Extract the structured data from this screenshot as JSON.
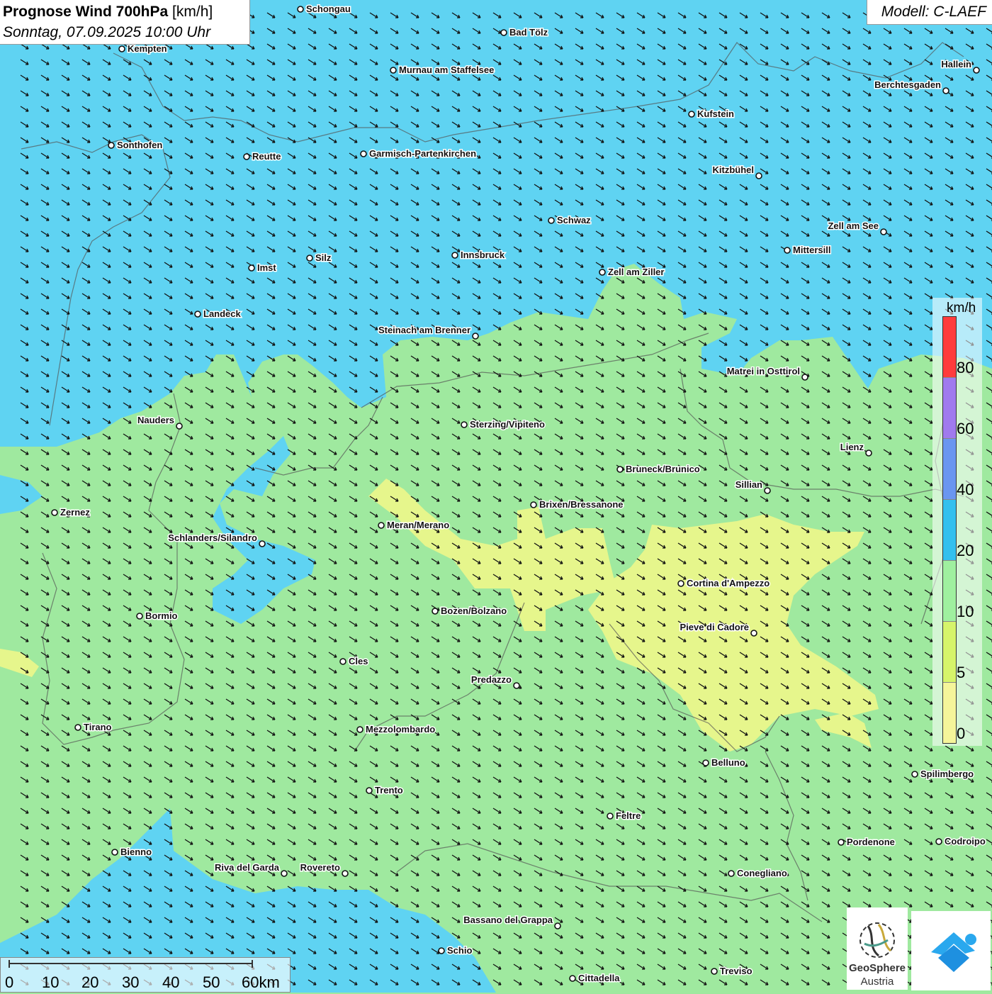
{
  "title": {
    "main": "Prognose Wind 700hPa",
    "unit": "[km/h]",
    "datetime": "Sonntag, 07.09.2025 10:00 Uhr"
  },
  "model": "Modell: C-LAEF",
  "colors": {
    "water": "#5fd4f2",
    "calm_green": "#a0ee9f",
    "yellow": "#e8f790",
    "dark_blue": "#3fb8ee"
  },
  "legend": {
    "unit": "km/h",
    "labels": [
      "80",
      "60",
      "40",
      "20",
      "10",
      "5",
      "0"
    ],
    "colors": [
      "#ff3c3c",
      "#a07aee",
      "#6a96f0",
      "#33c0ee",
      "#9ff09f",
      "#d6f46a",
      "#f5f59a"
    ]
  },
  "cities": [
    {
      "name": "Schongau"
    },
    {
      "name": "Bad Tölz"
    },
    {
      "name": "Kempten"
    },
    {
      "name": "Murnau am Staffelsee"
    },
    {
      "name": "Hallein"
    },
    {
      "name": "Berchtesgaden"
    },
    {
      "name": "Kufstein"
    },
    {
      "name": "Sonthofen"
    },
    {
      "name": "Reutte"
    },
    {
      "name": "Garmisch-Partenkirchen"
    },
    {
      "name": "Kitzbühel"
    },
    {
      "name": "Schwaz"
    },
    {
      "name": "Zell am See"
    },
    {
      "name": "Mittersill"
    },
    {
      "name": "Silz"
    },
    {
      "name": "Innsbruck"
    },
    {
      "name": "Imst"
    },
    {
      "name": "Zell am Ziller"
    },
    {
      "name": "Landeck"
    },
    {
      "name": "Steinach am Brenner"
    },
    {
      "name": "Matrei in Osttirol"
    },
    {
      "name": "Nauders"
    },
    {
      "name": "Sterzing/Vipiteno"
    },
    {
      "name": "Lienz"
    },
    {
      "name": "Bruneck/Brunico"
    },
    {
      "name": "Sillian"
    },
    {
      "name": "Zernez"
    },
    {
      "name": "Brixen/Bressanone"
    },
    {
      "name": "Meran/Merano"
    },
    {
      "name": "Schlanders/Silandro"
    },
    {
      "name": "Cortina d'Ampezzo"
    },
    {
      "name": "Bozen/Bolzano"
    },
    {
      "name": "Bormio"
    },
    {
      "name": "Pieve di Cadore"
    },
    {
      "name": "Cles"
    },
    {
      "name": "Predazzo"
    },
    {
      "name": "Tirano"
    },
    {
      "name": "Mezzolombardo"
    },
    {
      "name": "Belluno"
    },
    {
      "name": "Spilimbergo"
    },
    {
      "name": "Trento"
    },
    {
      "name": "Feltre"
    },
    {
      "name": "Bienno"
    },
    {
      "name": "Pordenone"
    },
    {
      "name": "Codroipo"
    },
    {
      "name": "Riva del Garda"
    },
    {
      "name": "Rovereto"
    },
    {
      "name": "Conegliano"
    },
    {
      "name": "Bassano del Grappa"
    },
    {
      "name": "Schio"
    },
    {
      "name": "Treviso"
    },
    {
      "name": "Cittadella"
    }
  ],
  "scale": {
    "labels": [
      "0",
      "10",
      "20",
      "30",
      "40",
      "50",
      "60km"
    ]
  },
  "logos": {
    "geosphere_line1": "GeoSphere",
    "geosphere_line2": "Austria"
  }
}
